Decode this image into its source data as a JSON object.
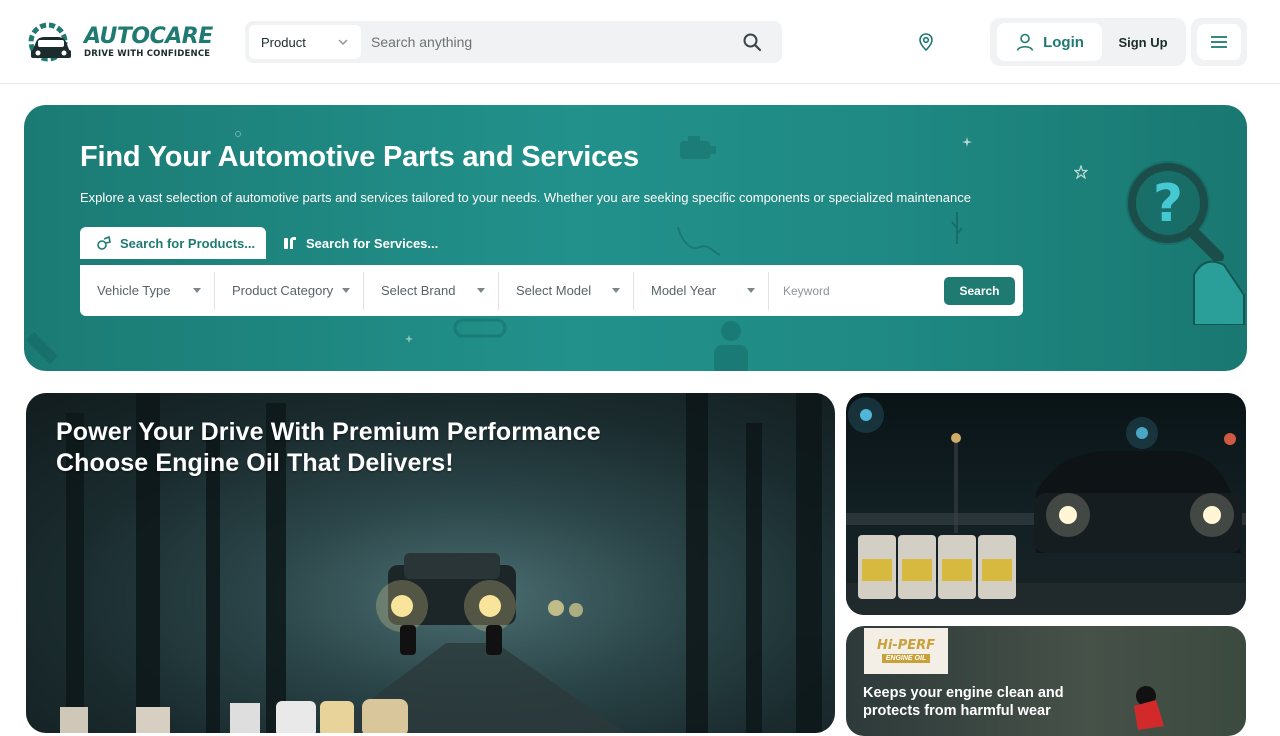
{
  "header": {
    "logo": {
      "name": "AUTOCARE",
      "tagline": "DRIVE WITH CONFIDENCE"
    },
    "search": {
      "category": "Product",
      "placeholder": "Search anything"
    },
    "login_label": "Login",
    "signup_label": "Sign Up"
  },
  "hero": {
    "title": "Find Your Automotive Parts and Services",
    "subtitle": "Explore a vast selection of automotive parts and services tailored to your needs. Whether you are seeking specific components or specialized maintenance",
    "tabs": [
      {
        "label": "Search for Products...",
        "active": true
      },
      {
        "label": "Search for Services...",
        "active": false
      }
    ],
    "filters": [
      "Vehicle Type",
      "Product Category",
      "Select Brand",
      "Select Model",
      "Model Year"
    ],
    "keyword_placeholder": "Keyword",
    "search_label": "Search"
  },
  "banners": {
    "main_title_line1": "Power Your Drive With Premium Performance",
    "main_title_line2": "Choose Engine Oil That Delivers!",
    "side_bottom": {
      "brand": "Hi-PERF",
      "brand_tag": "ENGINE OIL",
      "text_line1": "Keeps your engine clean and",
      "text_line2": "protects from harmful wear"
    }
  },
  "colors": {
    "brand": "#1f7a72",
    "hero_bg": "#1f8983"
  }
}
